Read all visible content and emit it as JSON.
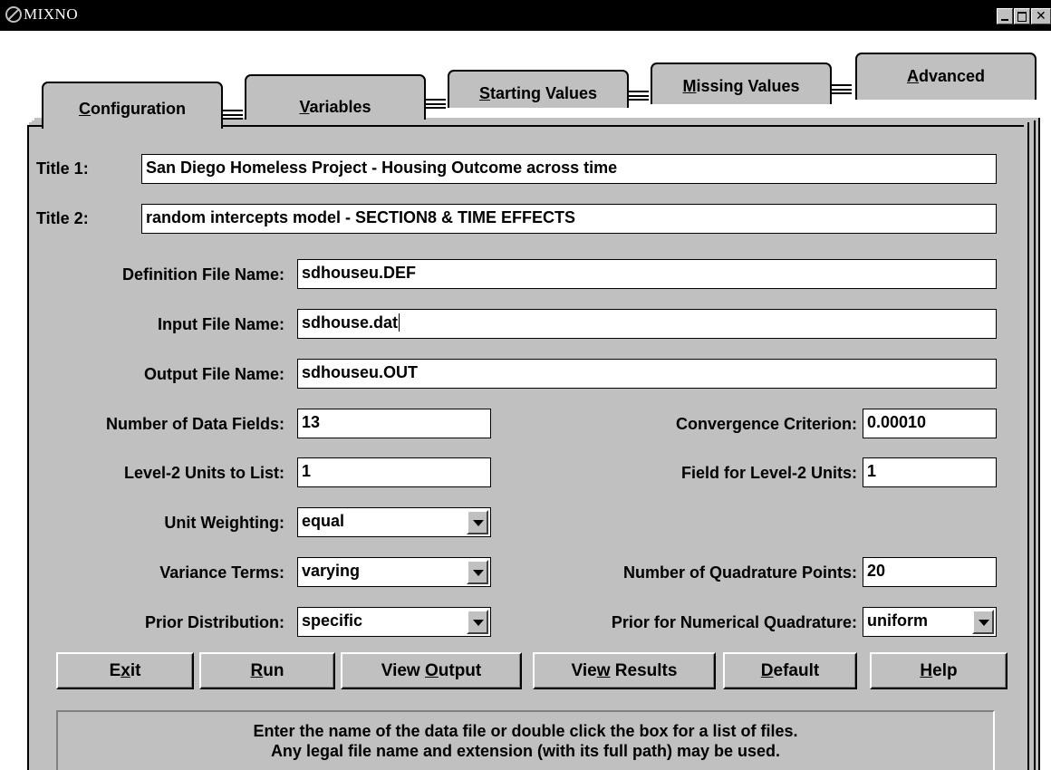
{
  "window": {
    "title": "MIXNO"
  },
  "tabs": [
    {
      "label": "Configuration",
      "accel": "C",
      "rest": "onfiguration"
    },
    {
      "label": "Variables",
      "accel": "V",
      "rest": "ariables"
    },
    {
      "label": "Starting Values",
      "accel": "S",
      "rest": "tarting Values"
    },
    {
      "label": "Missing Values",
      "accel": "M",
      "rest": "issing Values"
    },
    {
      "label": "Advanced",
      "accel": "A",
      "rest": "dvanced"
    }
  ],
  "active_tab": "Configuration",
  "form": {
    "title1": {
      "label": "Title 1:",
      "value": "San Diego Homeless Project - Housing Outcome across time"
    },
    "title2": {
      "label": "Title 2:",
      "value": "random intercepts model - SECTION8 & TIME EFFECTS"
    },
    "definition_file": {
      "label": "Definition File Name:",
      "value": "sdhouseu.DEF"
    },
    "input_file": {
      "label": "Input File Name:",
      "value": "sdhouse.dat"
    },
    "output_file": {
      "label": "Output File Name:",
      "value": "sdhouseu.OUT"
    },
    "num_data_fields": {
      "label": "Number of Data Fields:",
      "value": "13"
    },
    "level2_units": {
      "label": "Level-2 Units to List:",
      "value": "1"
    },
    "convergence": {
      "label": "Convergence Criterion:",
      "value": "0.00010"
    },
    "field_level2": {
      "label": "Field for Level-2 Units:",
      "value": "1"
    },
    "unit_weighting": {
      "label": "Unit Weighting:",
      "value": "equal"
    },
    "variance_terms": {
      "label": "Variance Terms:",
      "value": "varying"
    },
    "prior_distribution": {
      "label": "Prior Distribution:",
      "value": "specific"
    },
    "quadrature_points": {
      "label": "Number of Quadrature Points:",
      "value": "20"
    },
    "prior_numerical": {
      "label": "Prior for Numerical Quadrature:",
      "value": "uniform"
    }
  },
  "buttons": [
    {
      "label": "Exit",
      "pre": "E",
      "accel": "x",
      "post": "it"
    },
    {
      "label": "Run",
      "pre": "",
      "accel": "R",
      "post": "un"
    },
    {
      "label": "View Output",
      "pre": "View ",
      "accel": "O",
      "post": "utput"
    },
    {
      "label": "View Results",
      "pre": "Vie",
      "accel": "w",
      "post": " Results"
    },
    {
      "label": "Default",
      "pre": "",
      "accel": "D",
      "post": "efault"
    },
    {
      "label": "Help",
      "pre": "",
      "accel": "H",
      "post": "elp"
    }
  ],
  "status": {
    "line1": "Enter the name of the data file or double click the box for a list of files.",
    "line2": "Any legal file name and extension (with its full path) may be used."
  },
  "colors": {
    "face": "#c0c0c0",
    "titlebar": "#000000",
    "field": "#ffffff"
  },
  "icons": [
    "app-icon",
    "minimize-icon",
    "maximize-icon",
    "close-icon",
    "dropdown-arrow-icon"
  ]
}
